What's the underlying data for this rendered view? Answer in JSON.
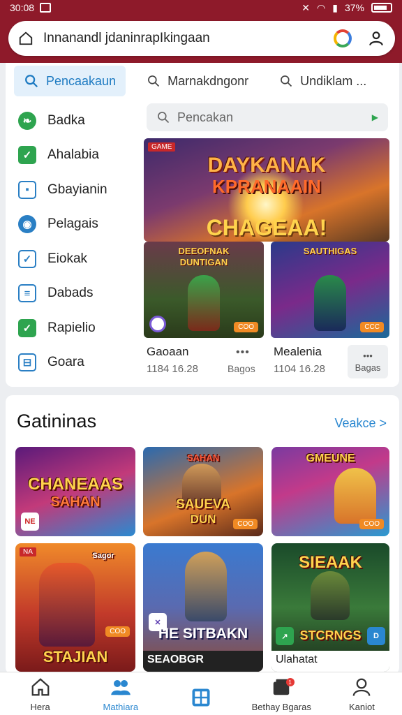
{
  "status_bar": {
    "time": "30:08",
    "battery": "37%"
  },
  "url_bar": {
    "text": "Innanandl jdaninrapIkingaan"
  },
  "tabs": [
    {
      "label": "Pencaakaun",
      "active": true
    },
    {
      "label": "Marnakdngonr"
    },
    {
      "label": "Undiklam ..."
    }
  ],
  "sidebar": {
    "items": [
      {
        "label": "Badka",
        "icon": "leaf-icon"
      },
      {
        "label": "Ahalabia",
        "icon": "check-icon"
      },
      {
        "label": "Gbayianin",
        "icon": "image-icon"
      },
      {
        "label": "Pelagais",
        "icon": "eye-icon"
      },
      {
        "label": "Eiokak",
        "icon": "check-box-icon"
      },
      {
        "label": "Dabads",
        "icon": "list-icon"
      },
      {
        "label": "Rapielio",
        "icon": "check-icon"
      },
      {
        "label": "Goara",
        "icon": "doc-icon"
      }
    ]
  },
  "search": {
    "placeholder": "Pencakan"
  },
  "featured": {
    "badge": "GAME",
    "title_line1": "DAYKANAK",
    "title_line2": "KPRANAAIN",
    "title_line3": "CHAGEAA!"
  },
  "thumbs": [
    {
      "title": "DEEOFNAK",
      "title2": "DUNTIGAN",
      "chip": "COO",
      "name": "Gaoaan",
      "time": "1184 16.28",
      "side_label": "Bagos"
    },
    {
      "title": "SAUTHIGAS",
      "chip": "CCC",
      "name": "Mealenia",
      "time": "1104 16.28",
      "side_label": "Bagas"
    }
  ],
  "section": {
    "title": "Gatininas",
    "link": "Veakce >"
  },
  "games": [
    {
      "title": "CHANEAAS",
      "title2": "SAHAN",
      "tag": "NE"
    },
    {
      "title": "SAUEVA",
      "title2": "DUN",
      "top": "SAHAN",
      "chip": "COO"
    },
    {
      "title": "GMEUNE",
      "chip": "COO"
    },
    {
      "title": "STAJIAN",
      "badge": "NA",
      "top": "Sagor",
      "chip": "COO"
    },
    {
      "title": "HE SITBAKN",
      "caption": "SEAOBGR"
    },
    {
      "title": "SIEAAK",
      "title2": "STCRNGS",
      "caption": "Ulahatat"
    }
  ],
  "bottom_nav": [
    {
      "label": "Hera",
      "icon": "home-icon"
    },
    {
      "label": "Mathiara",
      "icon": "people-icon",
      "active": true
    },
    {
      "label": "",
      "icon": "grid-icon"
    },
    {
      "label": "Bethay Bgaras",
      "icon": "folder-icon",
      "badge": "1"
    },
    {
      "label": "Kaniot",
      "icon": "person-icon"
    }
  ],
  "colors": {
    "header": "#8e1a2a",
    "accent": "#2a87d0",
    "green": "#2ea44f",
    "orange": "#f08a24"
  }
}
